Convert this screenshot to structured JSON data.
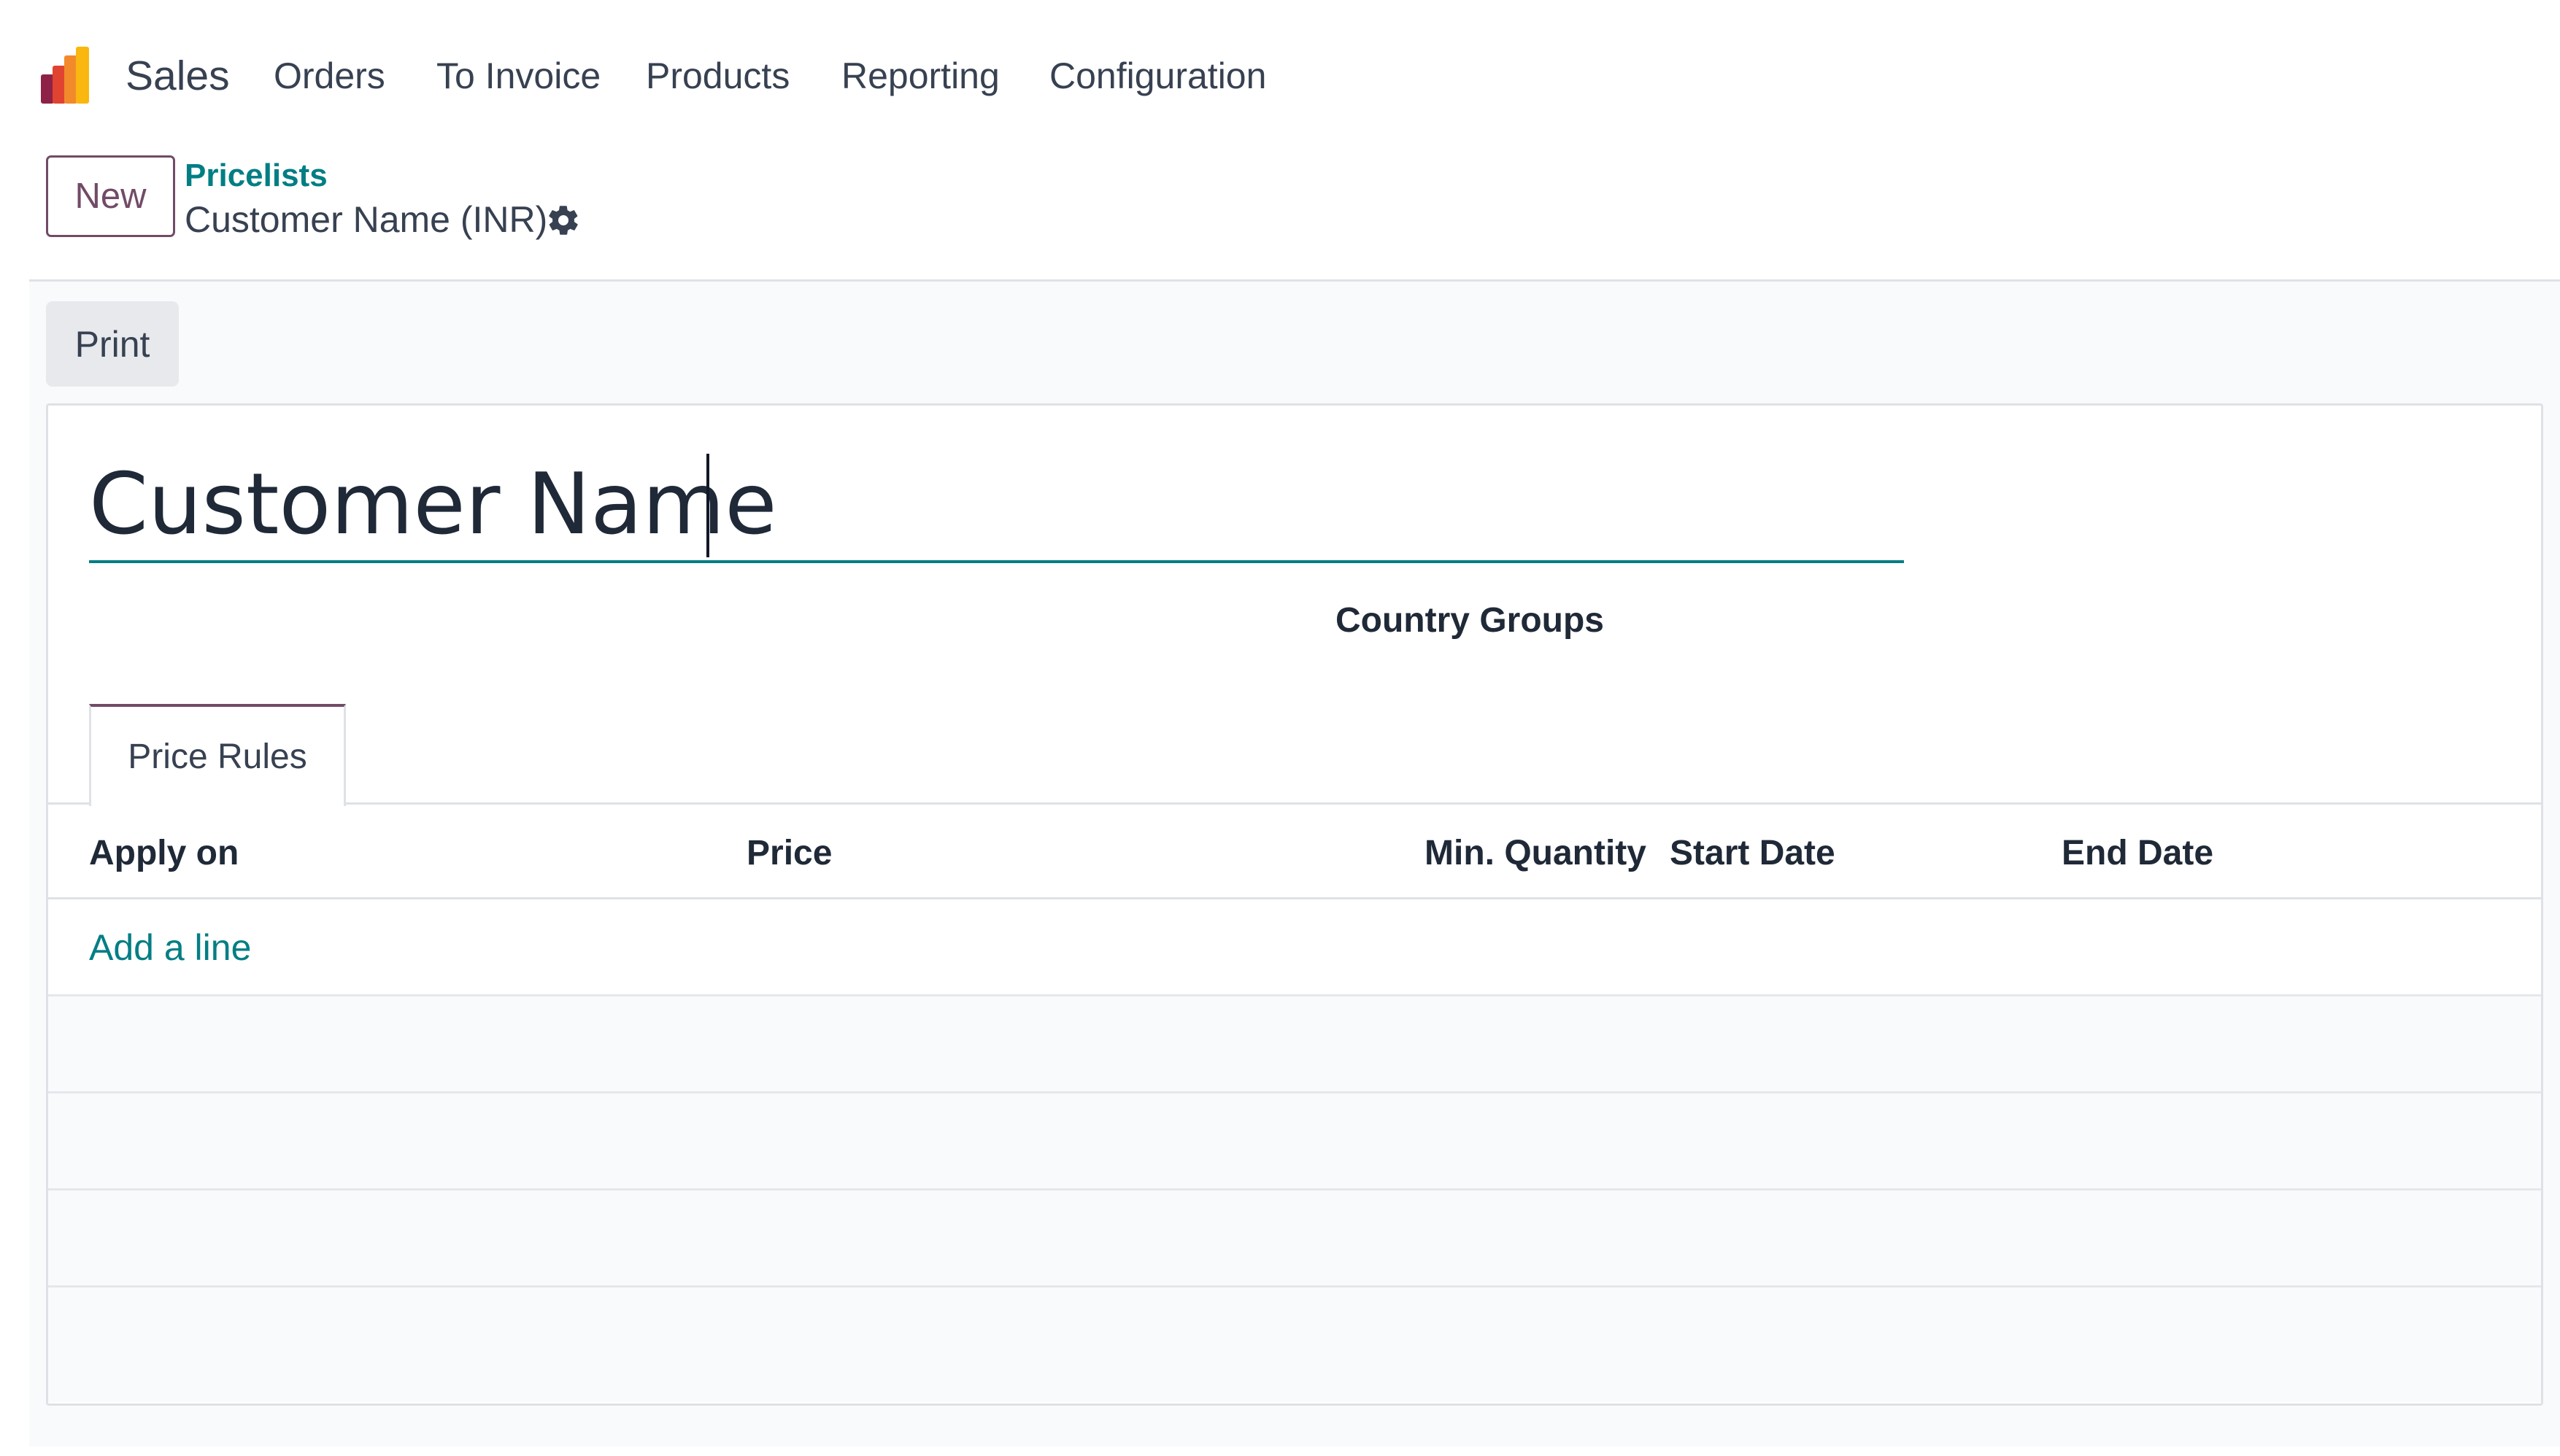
{
  "navbar": {
    "app_name": "Sales",
    "menu": [
      "Orders",
      "To Invoice",
      "Products",
      "Reporting",
      "Configuration"
    ]
  },
  "control_panel": {
    "new_label": "New",
    "breadcrumb_parent": "Pricelists",
    "breadcrumb_current": "Customer Name (INR)",
    "print_label": "Print"
  },
  "form": {
    "name_value": "Customer Name",
    "country_groups_label": "Country Groups"
  },
  "notebook": {
    "tab_label": "Price Rules",
    "columns": {
      "apply_on": "Apply on",
      "price": "Price",
      "min_quantity": "Min. Quantity",
      "start_date": "Start Date",
      "end_date": "End Date"
    },
    "add_line_label": "Add a line"
  },
  "colors": {
    "brand": "#714b67",
    "link": "#017e84",
    "border": "#dee2e6"
  },
  "icons": {
    "settings": "gear-icon",
    "app": "sales-app-icon"
  }
}
